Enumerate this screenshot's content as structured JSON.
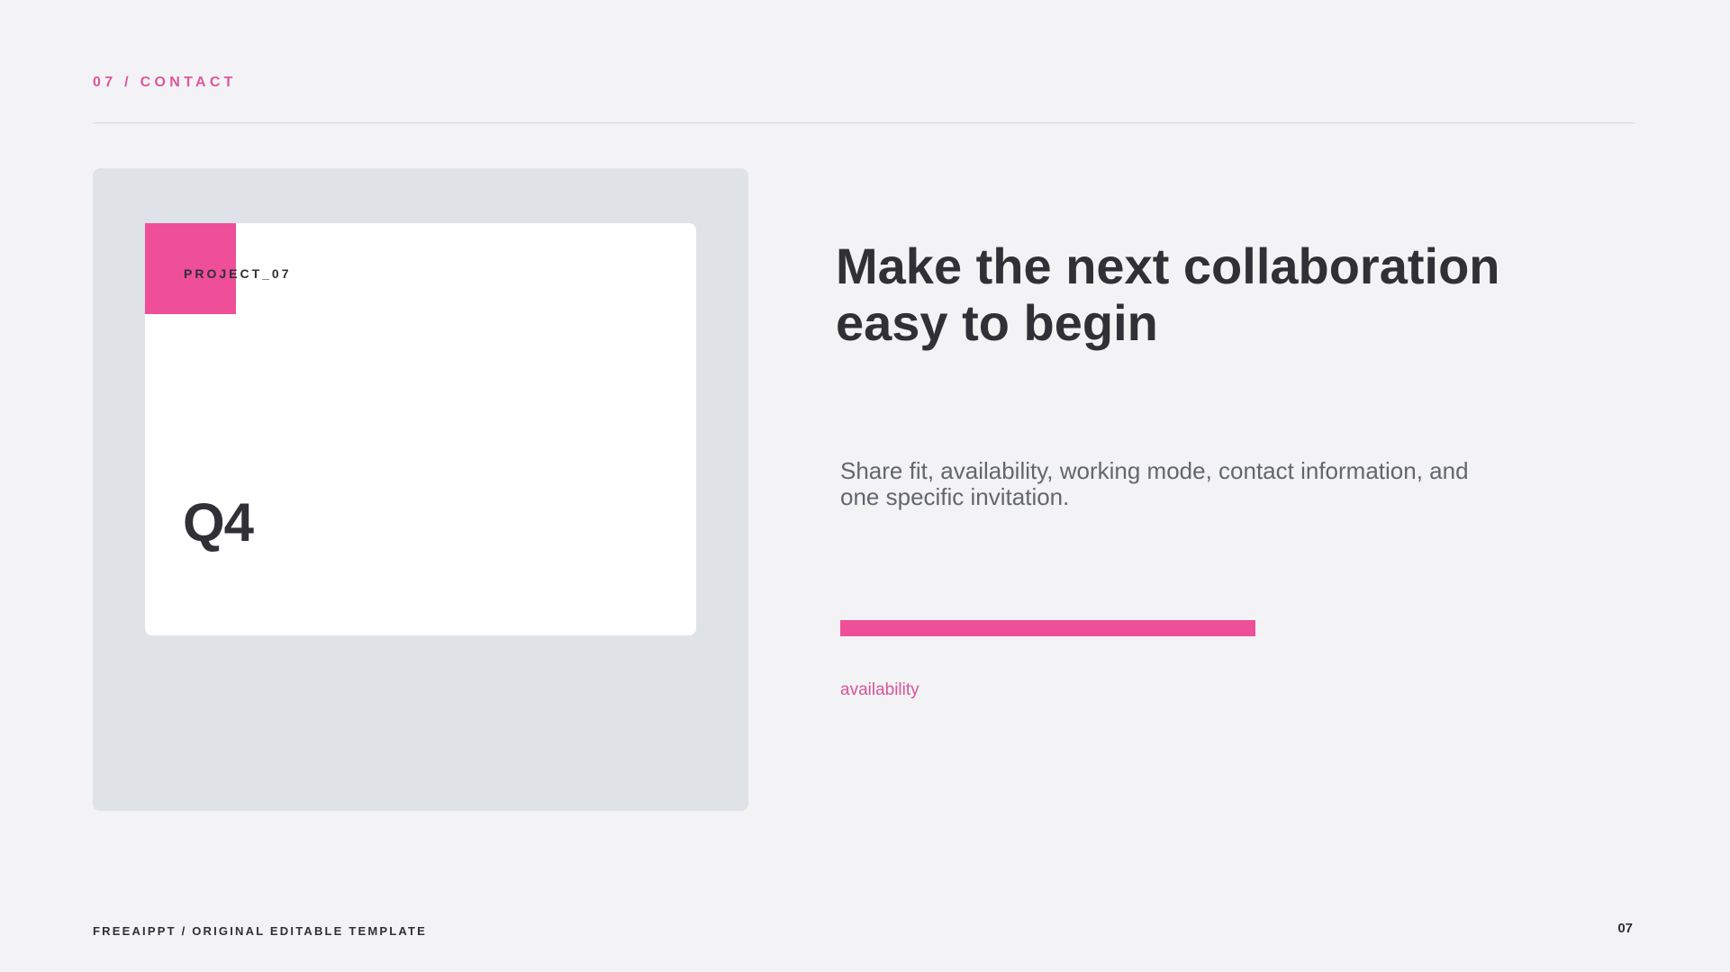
{
  "header": {
    "section_label": "07 / CONTACT"
  },
  "card": {
    "tag": "PROJECT_07",
    "value": "Q4"
  },
  "content": {
    "headline_line1": "Make the next collaboration",
    "headline_line2": "easy to begin",
    "body": "Share fit, availability, working mode, contact information, and one specific invitation.",
    "bar": {
      "label": "availability",
      "fill_fraction": 0.82
    }
  },
  "footer": {
    "brand": "FREEAIPPT / ORIGINAL EDITABLE TEMPLATE",
    "page_number": "07"
  },
  "colors": {
    "accent": "#ef4f99",
    "accent_text": "#e0559d",
    "background": "#f3f3f5",
    "panel": "#dfe3e7",
    "card": "#ffffff",
    "heading": "#303036",
    "body_text": "#63666d"
  }
}
